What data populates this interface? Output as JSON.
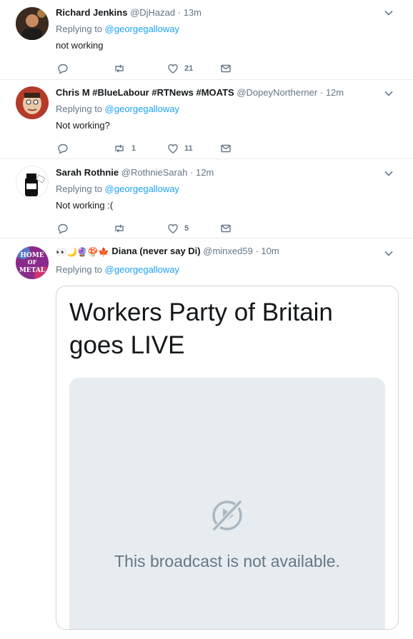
{
  "tweets": [
    {
      "name": "Richard Jenkins",
      "handle": "@DjHazad",
      "sep": "·",
      "time": "13m",
      "replying_prefix": "Replying to",
      "replying_to": "@georgegalloway",
      "text": "not working",
      "retweets": "",
      "likes": "21"
    },
    {
      "name": "Chris M #BlueLabour #RTNews #MOATS",
      "handle": "@DopeyNortherner",
      "sep": "·",
      "time": "12m",
      "replying_prefix": "Replying to",
      "replying_to": "@georgegalloway",
      "text": "Not working?",
      "retweets": "1",
      "likes": "11"
    },
    {
      "name": "Sarah Rothnie",
      "handle": "@RothnieSarah",
      "sep": "·",
      "time": "12m",
      "replying_prefix": "Replying to",
      "replying_to": "@georgegalloway",
      "text": "Not working :(",
      "retweets": "",
      "likes": "5"
    },
    {
      "name_emoji": "👀🌙🔮🍄🍁",
      "name": "Diana (never say Di)",
      "handle": "@minxed59",
      "sep": "·",
      "time": "10m",
      "replying_prefix": "Replying to",
      "replying_to": "@georgegalloway",
      "card_title": "Workers Party of Britain goes LIVE",
      "card_message": "This broadcast is not available.",
      "avatar_text": [
        "HOME",
        "OF",
        "METAL"
      ]
    }
  ],
  "icons": [
    "caret-down-icon",
    "reply-icon",
    "retweet-icon",
    "like-icon",
    "message-icon",
    "broadcast-unavailable-icon"
  ],
  "colors": {
    "link": "#1da1f2",
    "secondary": "#657786",
    "border": "#e6ecf0",
    "text": "#14171a"
  }
}
